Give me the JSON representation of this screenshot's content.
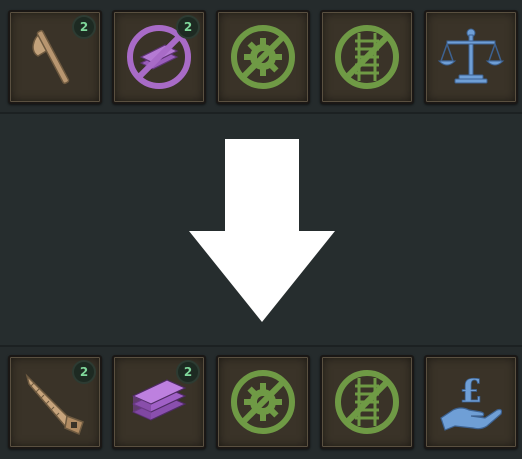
{
  "top_row": {
    "slots": [
      {
        "icon": "axe-icon",
        "badge": "2"
      },
      {
        "icon": "disabled-planks-icon",
        "badge": "2"
      },
      {
        "icon": "disabled-gear-icon"
      },
      {
        "icon": "disabled-railway-icon"
      },
      {
        "icon": "scales-icon"
      }
    ]
  },
  "bottom_row": {
    "slots": [
      {
        "icon": "saw-icon",
        "badge": "2"
      },
      {
        "icon": "planks-icon",
        "badge": "2"
      },
      {
        "icon": "disabled-gear-icon"
      },
      {
        "icon": "disabled-railway-icon"
      },
      {
        "icon": "pound-hand-icon"
      }
    ]
  },
  "arrow": {
    "icon": "down-arrow-icon",
    "color": "#ffffff"
  },
  "colors": {
    "tan": "#b89670",
    "purple": "#a86bc7",
    "green": "#6f9a45",
    "blue": "#6f9fd6",
    "badge_text": "#7fd79a"
  }
}
